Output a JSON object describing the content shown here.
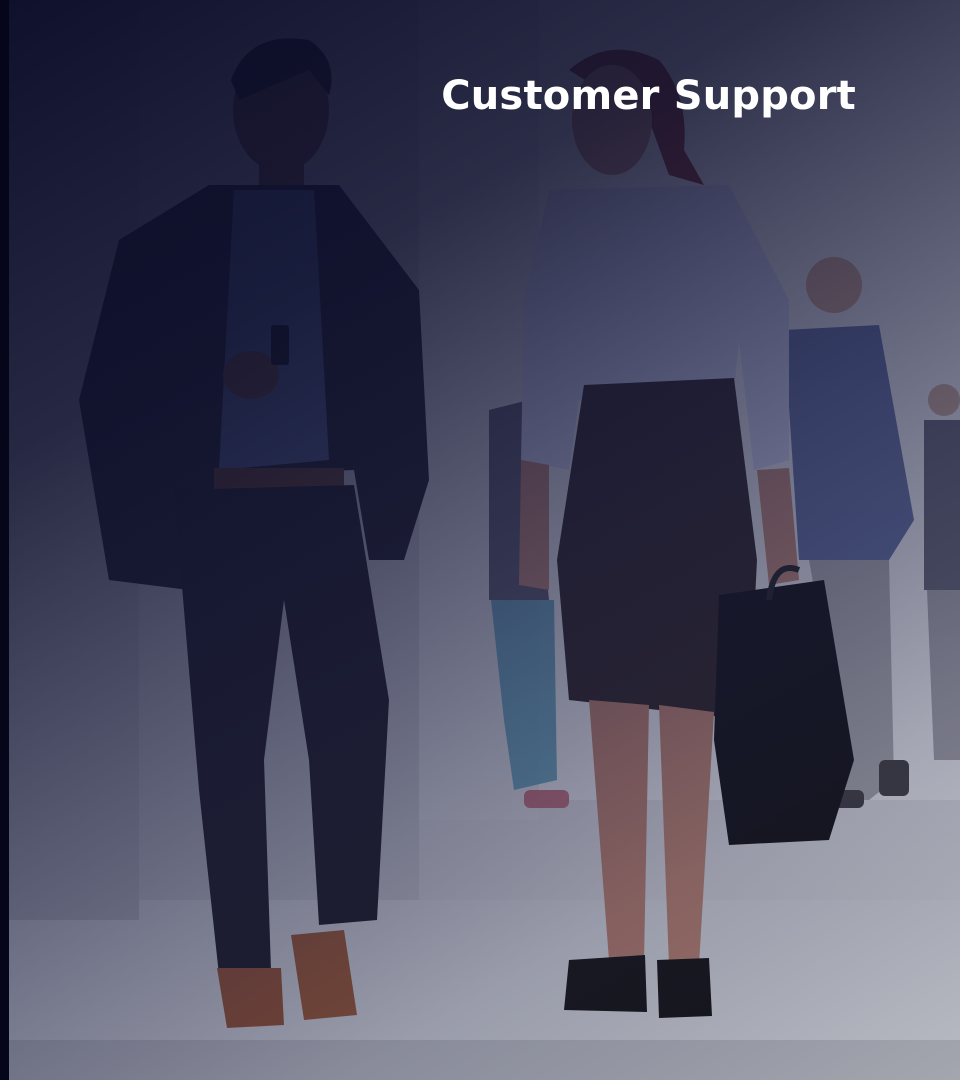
{
  "hero": {
    "title": "Customer Support",
    "image_subject": "business people walking in a corridor",
    "overlay_color": "#0b0d2a",
    "title_color": "#ffffff"
  }
}
